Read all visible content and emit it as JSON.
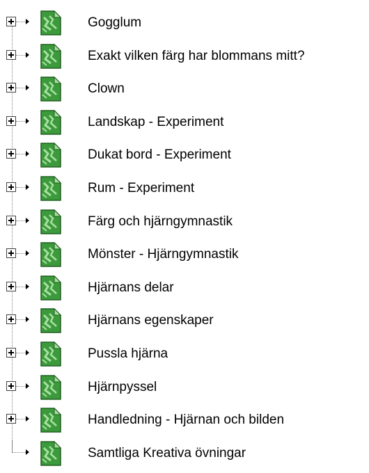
{
  "tree": {
    "items": [
      {
        "label": "Gogglum",
        "expandable": true
      },
      {
        "label": "Exakt vilken färg har blommans mitt?",
        "expandable": true
      },
      {
        "label": "Clown",
        "expandable": true
      },
      {
        "label": "Landskap - Experiment",
        "expandable": true
      },
      {
        "label": "Dukat bord - Experiment",
        "expandable": true
      },
      {
        "label": "Rum - Experiment",
        "expandable": true
      },
      {
        "label": "Färg och hjärngymnastik",
        "expandable": true
      },
      {
        "label": "Mönster - Hjärngymnastik",
        "expandable": true
      },
      {
        "label": "Hjärnans delar",
        "expandable": true
      },
      {
        "label": "Hjärnans egenskaper",
        "expandable": true
      },
      {
        "label": "Pussla hjärna",
        "expandable": true
      },
      {
        "label": "Hjärnpyssel",
        "expandable": true
      },
      {
        "label": "Handledning - Hjärnan och bilden",
        "expandable": true
      },
      {
        "label": "Samtliga Kreativa övningar",
        "expandable": false
      }
    ],
    "icon": "document-icon",
    "colors": {
      "icon_fill": "#3c9a3c",
      "icon_dark": "#1f5f1f",
      "icon_light": "#a8e0a0"
    }
  }
}
